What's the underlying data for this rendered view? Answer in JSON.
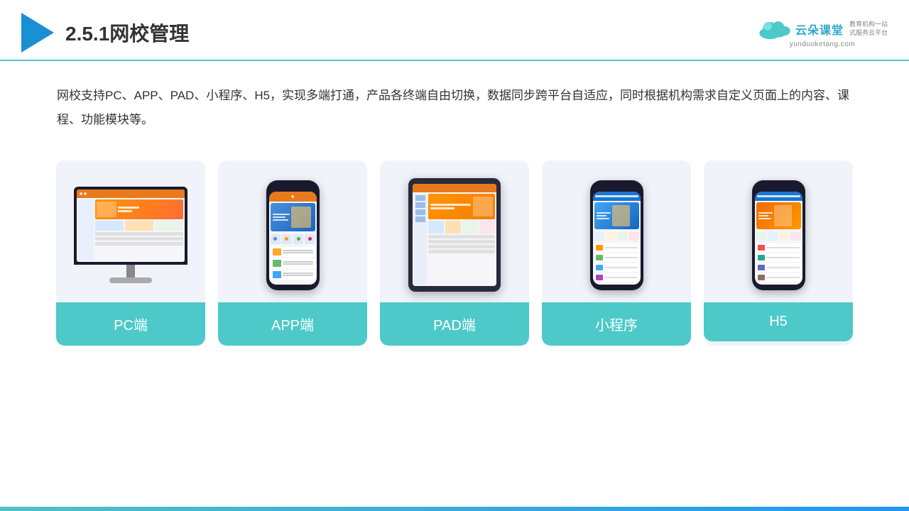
{
  "header": {
    "title": "2.5.1网校管理",
    "brand": {
      "name_cn": "云朵课堂",
      "url": "yunduoketang.com",
      "tagline": "教育机构一站\n式服务云平台"
    }
  },
  "description": "网校支持PC、APP、PAD、小程序、H5，实现多端打通，产品各终端自由切换，数据同步跨平台自适应，同时根据机构需求自定义页面上的内容、课程、功能模块等。",
  "cards": [
    {
      "id": "pc",
      "label": "PC端"
    },
    {
      "id": "app",
      "label": "APP端"
    },
    {
      "id": "pad",
      "label": "PAD端"
    },
    {
      "id": "miniprogram",
      "label": "小程序"
    },
    {
      "id": "h5",
      "label": "H5"
    }
  ],
  "colors": {
    "teal": "#4dc9c9",
    "accent": "#1a90d4",
    "header_border": "#4fc3c8"
  }
}
